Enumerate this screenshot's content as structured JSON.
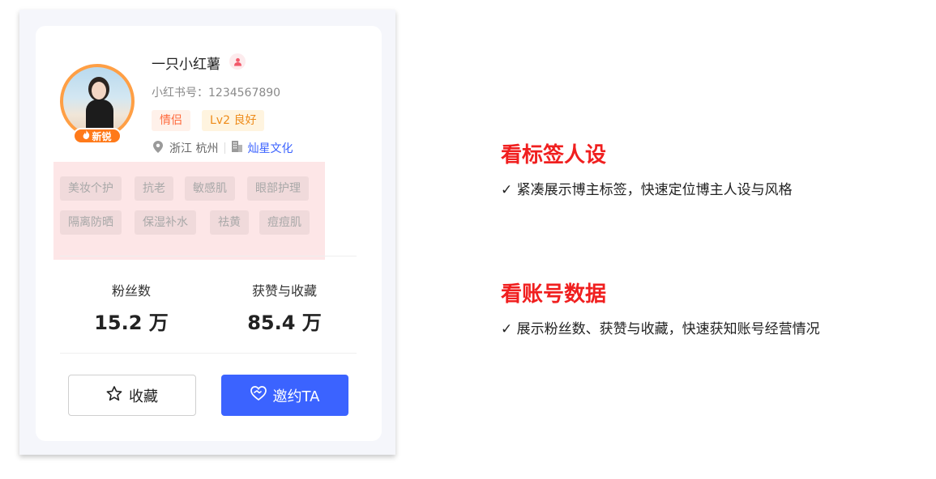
{
  "profile": {
    "name": "一只小红薯",
    "id_line": "小红书号：1234567890",
    "badge_new": "新锐",
    "tags": [
      "情侣",
      "Lv2 良好"
    ],
    "location": "浙江 杭州",
    "company": "灿星文化",
    "keywords": [
      "美妆个护",
      "抗老",
      "敏感肌",
      "眼部护理",
      "隔离防晒",
      "保湿补水",
      "祛黄",
      "痘痘肌"
    ]
  },
  "stats": {
    "followers_label": "粉丝数",
    "followers_value": "15.2 万",
    "likes_label": "获赞与收藏",
    "likes_value": "85.4 万"
  },
  "actions": {
    "favorite_label": "收藏",
    "invite_label": "邀约TA"
  },
  "features": [
    {
      "title": "看标签人设",
      "desc": "✓  紧凑展示博主标签，快速定位博主人设与风格"
    },
    {
      "title": "看账号数据",
      "desc": "✓  展示粉丝数、获赞与收藏，快速获知账号经营情况"
    }
  ],
  "colors": {
    "accent_blue": "#3b63ff",
    "title_red": "#f01f1f",
    "avatar_ring": "#ff9f45"
  }
}
